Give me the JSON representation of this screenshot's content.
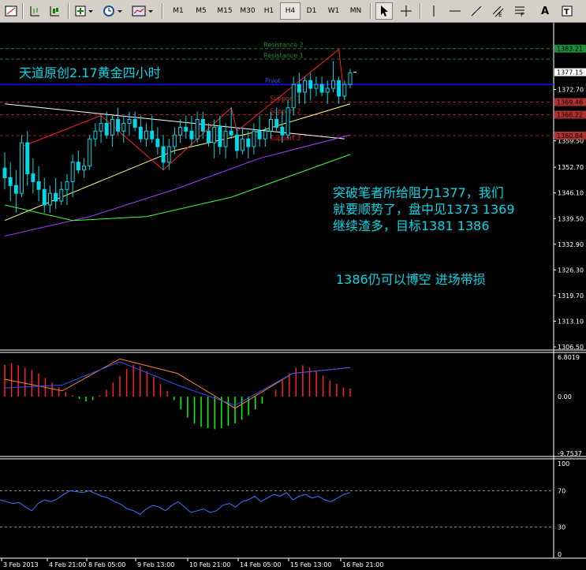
{
  "toolbar": {
    "timeframes": [
      "M1",
      "M5",
      "M15",
      "M30",
      "H1",
      "H4",
      "D1",
      "W1",
      "MN"
    ],
    "active_timeframe": "H4",
    "text_tool": "A",
    "icons": [
      "bar-chart-icon",
      "candle-chart-icon",
      "line-chart-icon",
      "new-chart-icon",
      "period-clock-icon",
      "template-icon",
      "cursor-icon",
      "crosshair-icon",
      "vertical-line-icon",
      "horizontal-line-icon",
      "trend-line-icon",
      "channel-icon",
      "fibonacci-icon",
      "text-icon",
      "label-icon"
    ]
  },
  "chart_title": "天道原创2.17黄金四小时",
  "annotations": {
    "line1": "突破笔者所给阻力1377，我们",
    "line2": "就要顺势了，盘中见1373   1369",
    "line3": "继续渣多，目标1381   1386",
    "line4": "1386仍可以博空   进场带损"
  },
  "levels": {
    "resistance2": "Resistance 2",
    "resistance1": "Resistance 1",
    "pivot": "Pivot",
    "support1": "Support 1",
    "support2": "Support 2",
    "support3": "Support 3"
  },
  "price_axis_ticks": [
    "1359.50",
    "1352.70",
    "1346.10",
    "1339.50",
    "1332.90",
    "1326.30",
    "1319.70",
    "1313.10",
    "1306.50",
    "1372.70"
  ],
  "price_axis_badges": [
    {
      "label": "1383.21",
      "color": "#1e8c3a"
    },
    {
      "label": "1377.15",
      "color": "#ffffff"
    },
    {
      "label": "1369.46",
      "color": "#b03030"
    },
    {
      "label": "1366.22",
      "color": "#b03030"
    },
    {
      "label": "1360.84",
      "color": "#b03030"
    }
  ],
  "macd_axis": [
    "6.8019",
    "0.00",
    "-9.7537"
  ],
  "rsi_axis": [
    "100",
    "70",
    "30",
    "0"
  ],
  "time_axis": [
    "3 Feb 2013",
    "4 Feb 21:00",
    "8 Feb 05:00",
    "9 Feb 13:00",
    "10 Feb 21:00",
    "14 Feb 05:00",
    "15 Feb 13:00",
    "16 Feb 21:00"
  ],
  "colors": {
    "background": "#000000",
    "bull": "#00d8e8",
    "bear": "#00d8e8",
    "ma_fast": "#ffffff",
    "ma_mid": "#ffff80",
    "ma_slow": "#a040ff",
    "ma_long": "#40ff40",
    "zigzag": "#ff2020",
    "pivot_line": "#0000ff",
    "macd_pos": "#ff2020",
    "macd_neg": "#00ff00",
    "rsi": "#3a78ff"
  },
  "chart_data": [
    {
      "type": "candlestick",
      "title": "天道原创2.17黄金四小时",
      "ylim": [
        1306.5,
        1387
      ],
      "candles": [
        [
          1352.5,
          1356.5,
          1347,
          1350
        ],
        [
          1350,
          1354,
          1344,
          1348
        ],
        [
          1348,
          1352,
          1341,
          1346
        ],
        [
          1346,
          1361,
          1345,
          1359
        ],
        [
          1359,
          1362,
          1348,
          1351
        ],
        [
          1351,
          1355,
          1346,
          1349
        ],
        [
          1349,
          1353,
          1344,
          1347
        ],
        [
          1347,
          1350,
          1341,
          1343
        ],
        [
          1343,
          1348,
          1341,
          1346
        ],
        [
          1346,
          1350,
          1342,
          1344
        ],
        [
          1344,
          1349,
          1343,
          1347
        ],
        [
          1347,
          1351,
          1343,
          1349
        ],
        [
          1349,
          1356,
          1345,
          1354
        ],
        [
          1354,
          1357,
          1351,
          1352
        ],
        [
          1352,
          1355,
          1350,
          1353
        ],
        [
          1353,
          1361,
          1352,
          1360
        ],
        [
          1360,
          1364,
          1358,
          1362
        ],
        [
          1362,
          1366,
          1359,
          1364
        ],
        [
          1364,
          1367,
          1360,
          1361
        ],
        [
          1361,
          1366,
          1358,
          1365
        ],
        [
          1365,
          1368,
          1361,
          1362
        ],
        [
          1362,
          1366,
          1359,
          1364
        ],
        [
          1364,
          1367,
          1361,
          1365
        ],
        [
          1365,
          1367,
          1362,
          1363
        ],
        [
          1363,
          1366,
          1359,
          1360
        ],
        [
          1360,
          1364,
          1358,
          1362
        ],
        [
          1362,
          1366,
          1359,
          1360
        ],
        [
          1360,
          1363,
          1356,
          1358
        ],
        [
          1358,
          1361,
          1352,
          1354
        ],
        [
          1354,
          1360,
          1352,
          1358
        ],
        [
          1358,
          1363,
          1356,
          1361
        ],
        [
          1361,
          1365,
          1359,
          1363
        ],
        [
          1363,
          1366,
          1360,
          1362
        ],
        [
          1362,
          1366,
          1358,
          1360
        ],
        [
          1360,
          1367,
          1359,
          1365
        ],
        [
          1365,
          1367,
          1360,
          1362
        ],
        [
          1362,
          1364,
          1358,
          1359
        ],
        [
          1359,
          1365,
          1355,
          1363
        ],
        [
          1363,
          1366,
          1356,
          1358
        ],
        [
          1358,
          1364,
          1355,
          1362
        ],
        [
          1362,
          1368,
          1360,
          1361
        ],
        [
          1361,
          1363,
          1355,
          1357
        ],
        [
          1357,
          1363,
          1356,
          1360
        ],
        [
          1360,
          1362,
          1355,
          1358
        ],
        [
          1358,
          1364,
          1356,
          1362
        ],
        [
          1362,
          1366,
          1358,
          1360
        ],
        [
          1360,
          1363,
          1358,
          1362
        ],
        [
          1362,
          1367,
          1360,
          1365
        ],
        [
          1365,
          1368,
          1362,
          1363
        ],
        [
          1363,
          1367,
          1359,
          1361
        ],
        [
          1361,
          1370,
          1360,
          1368
        ],
        [
          1368,
          1376,
          1366,
          1374
        ],
        [
          1374,
          1377,
          1369,
          1372
        ],
        [
          1372,
          1376,
          1369,
          1375
        ],
        [
          1375,
          1377,
          1370,
          1373
        ],
        [
          1373,
          1376,
          1371,
          1374
        ],
        [
          1374,
          1376,
          1371,
          1372
        ],
        [
          1372,
          1375,
          1369,
          1373
        ],
        [
          1373,
          1380,
          1372,
          1375
        ],
        [
          1375,
          1376,
          1369,
          1371
        ],
        [
          1371,
          1375,
          1370,
          1374
        ],
        [
          1374,
          1378,
          1373,
          1377
        ]
      ],
      "zigzag": [
        [
          3,
          1358
        ],
        [
          17,
          1366
        ],
        [
          28,
          1352
        ],
        [
          40,
          1368
        ],
        [
          41,
          1362
        ],
        [
          59,
          1383
        ],
        [
          60,
          1370
        ]
      ],
      "levels": [
        {
          "name": "Resistance 2",
          "price": 1383.21
        },
        {
          "name": "Resistance 1",
          "price": 1380.5
        },
        {
          "name": "Pivot",
          "price": 1374
        },
        {
          "name": "Support 1",
          "price": 1369.46
        },
        {
          "name": "Support 2",
          "price": 1366.22
        },
        {
          "name": "Support 3",
          "price": 1360.84
        }
      ],
      "moving_averages": [
        {
          "name": "MA-white",
          "color": "#ffffff",
          "values": [
            [
              0,
              1369
            ],
            [
              20,
              1366
            ],
            [
              40,
              1363
            ],
            [
              60,
              1360
            ]
          ]
        },
        {
          "name": "MA-yellow",
          "color": "#ffff80",
          "values": [
            [
              0,
              1339
            ],
            [
              15,
              1348
            ],
            [
              30,
              1357
            ],
            [
              45,
              1362
            ],
            [
              61,
              1369
            ]
          ]
        },
        {
          "name": "MA-purple",
          "color": "#a040ff",
          "values": [
            [
              0,
              1335
            ],
            [
              15,
              1340
            ],
            [
              30,
              1347
            ],
            [
              45,
              1355
            ],
            [
              61,
              1361
            ]
          ]
        },
        {
          "name": "MA-green",
          "color": "#40ff40",
          "values": [
            [
              0,
              1343
            ],
            [
              12,
              1339
            ],
            [
              25,
              1340
            ],
            [
              40,
              1345
            ],
            [
              61,
              1356
            ]
          ]
        }
      ]
    },
    {
      "type": "bar",
      "title": "MACD",
      "ylim": [
        -9.7537,
        6.8019
      ],
      "values": [
        5.5,
        5.8,
        5.4,
        5,
        4.6,
        4,
        3.2,
        2.4,
        1.6,
        0.8,
        0.2,
        -0.4,
        -0.8,
        -0.6,
        0.2,
        1.2,
        2.4,
        3.6,
        4.8,
        5.5,
        5.2,
        4.4,
        3.4,
        2.2,
        1,
        -0.6,
        -2.2,
        -3.6,
        -4.6,
        -5.2,
        -5.4,
        -5.6,
        -5.4,
        -5,
        -4.6,
        -4,
        -3.2,
        -2.2,
        -1.2,
        0,
        1.2,
        2.8,
        4,
        5,
        5.4,
        5,
        4.4,
        3.6,
        2.8,
        2.2,
        1.6,
        1.4
      ],
      "signal": [
        [
          0,
          1.5
        ],
        [
          10,
          2
        ],
        [
          20,
          6
        ],
        [
          30,
          2
        ],
        [
          40,
          -1.5
        ],
        [
          50,
          4
        ],
        [
          60,
          5
        ]
      ],
      "main": [
        [
          0,
          3
        ],
        [
          10,
          1
        ],
        [
          20,
          6.5
        ],
        [
          30,
          4
        ],
        [
          40,
          -2
        ],
        [
          50,
          4
        ],
        [
          60,
          5
        ]
      ]
    },
    {
      "type": "line",
      "title": "RSI",
      "ylim": [
        0,
        100
      ],
      "x": [
        0,
        4,
        8,
        12,
        16,
        20,
        24,
        28,
        32,
        36,
        40,
        44,
        48,
        52,
        56,
        60,
        64,
        68,
        72,
        76,
        80,
        84,
        88,
        92,
        96,
        100,
        104,
        108,
        112,
        116,
        120,
        124,
        128,
        132,
        136,
        140,
        144,
        148,
        152,
        156,
        160,
        164,
        168,
        172,
        176,
        180,
        184,
        188,
        192,
        196,
        200,
        204,
        208,
        212,
        216,
        220
      ],
      "values": [
        60,
        58,
        56,
        57,
        52,
        48,
        56,
        60,
        58,
        61,
        66,
        70,
        69,
        68,
        70,
        67,
        64,
        62,
        58,
        55,
        50,
        48,
        44,
        50,
        54,
        52,
        48,
        54,
        58,
        52,
        46,
        48,
        50,
        46,
        48,
        54,
        56,
        52,
        58,
        60,
        64,
        58,
        62,
        66,
        64,
        68,
        60,
        64,
        66,
        62,
        64,
        60,
        58,
        62,
        66,
        68
      ]
    }
  ]
}
